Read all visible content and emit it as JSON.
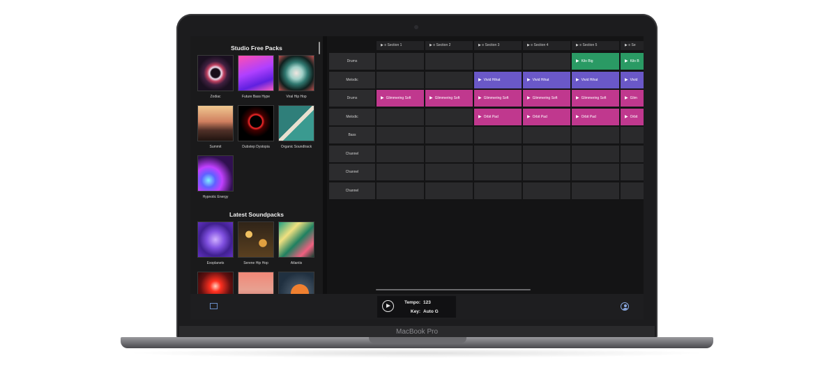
{
  "device": {
    "label": "MacBook Pro"
  },
  "sidebar": {
    "free_title": "Studio Free Packs",
    "free_packs": [
      {
        "label": "Zodiac",
        "art": "nebula-ring"
      },
      {
        "label": "Future Bass Hype",
        "art": "pink-purple-waves"
      },
      {
        "label": "Viral Hip Hop",
        "art": "teal-sphere"
      },
      {
        "label": "Summit",
        "art": "mountain-sunset"
      },
      {
        "label": "Dubstep Dystopia",
        "art": "red-neon-frame"
      },
      {
        "label": "Organic Soundtrack",
        "art": "teal-chevron"
      },
      {
        "label": "Hypnotic Energy",
        "art": "purple-rings"
      }
    ],
    "latest_title": "Latest Soundpacks",
    "latest_packs": [
      {
        "label": "Exoplanets",
        "art": "violet-geometry"
      },
      {
        "label": "Serene Hip Hop",
        "art": "bokeh-lights"
      },
      {
        "label": "Atlantis",
        "art": "green-foliage"
      },
      {
        "label": "",
        "art": "red-glow"
      },
      {
        "label": "",
        "art": "salmon-gradient"
      },
      {
        "label": "",
        "art": "orange-planet"
      }
    ]
  },
  "grid": {
    "sections": [
      "Section 1",
      "Section 2",
      "Section 3",
      "Section 4",
      "Section 5",
      "Se"
    ],
    "tracks": [
      "Drums",
      "Melodic",
      "Drums",
      "Melodic",
      "Bass",
      "Channel",
      "Channel",
      "Channel"
    ],
    "clips": [
      {
        "track": 0,
        "section": 4,
        "label": "Kilo Big",
        "color": "#2a9a64"
      },
      {
        "track": 0,
        "section": 5,
        "label": "Kilo B",
        "color": "#2a9a64"
      },
      {
        "track": 1,
        "section": 2,
        "label": "Vivid Hihat",
        "color": "#6a58c8"
      },
      {
        "track": 1,
        "section": 3,
        "label": "Vivid Hihat",
        "color": "#6a58c8"
      },
      {
        "track": 1,
        "section": 4,
        "label": "Vivid Hihat",
        "color": "#6a58c8"
      },
      {
        "track": 1,
        "section": 5,
        "label": "Vivid",
        "color": "#6a58c8"
      },
      {
        "track": 2,
        "section": 0,
        "label": "Glimmering Soft",
        "color": "#c0388e"
      },
      {
        "track": 2,
        "section": 1,
        "label": "Glimmering Soft",
        "color": "#c0388e"
      },
      {
        "track": 2,
        "section": 2,
        "label": "Glimmering Soft",
        "color": "#c0388e"
      },
      {
        "track": 2,
        "section": 3,
        "label": "Glimmering Soft",
        "color": "#c0388e"
      },
      {
        "track": 2,
        "section": 4,
        "label": "Glimmering Soft",
        "color": "#c0388e"
      },
      {
        "track": 2,
        "section": 5,
        "label": "Glim",
        "color": "#c0388e"
      },
      {
        "track": 3,
        "section": 2,
        "label": "Orbit Pad",
        "color": "#c0388e"
      },
      {
        "track": 3,
        "section": 3,
        "label": "Orbit Pad",
        "color": "#c0388e"
      },
      {
        "track": 3,
        "section": 4,
        "label": "Orbit Pad",
        "color": "#c0388e"
      },
      {
        "track": 3,
        "section": 5,
        "label": "Orbit",
        "color": "#c0388e"
      }
    ]
  },
  "transport": {
    "tempo_label": "Tempo:",
    "tempo_value": "123",
    "key_label": "Key:",
    "key_value": "Auto G"
  },
  "icons": {
    "sidebar_toggle": "sidebar-toggle-icon",
    "play": "play-icon",
    "user": "user-icon"
  }
}
